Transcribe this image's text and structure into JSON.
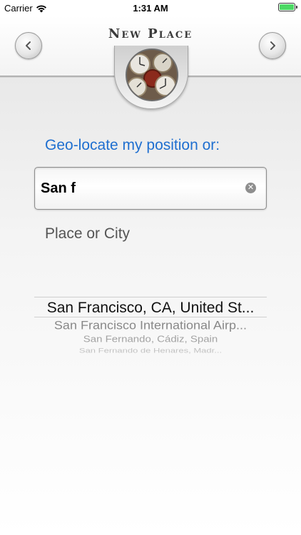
{
  "status_bar": {
    "carrier": "Carrier",
    "time": "1:31 AM"
  },
  "header": {
    "title": "New Place",
    "back_icon": "chevron-left-icon",
    "forward_icon": "chevron-right-icon",
    "logo_icon": "clocks-logo"
  },
  "geo": {
    "label": "Geo-locate my position or:"
  },
  "search": {
    "value": "San f",
    "clear_icon": "clear-icon"
  },
  "hint": "Place or City",
  "picker": {
    "options": [
      "San Francisco, CA, United St...",
      "San Francisco International Airp...",
      "San Fernando, Cádiz, Spain",
      "San Fernando de Henares, Madr..."
    ]
  },
  "colors": {
    "accent": "#1f6fd0",
    "battery": "#4cd964"
  }
}
